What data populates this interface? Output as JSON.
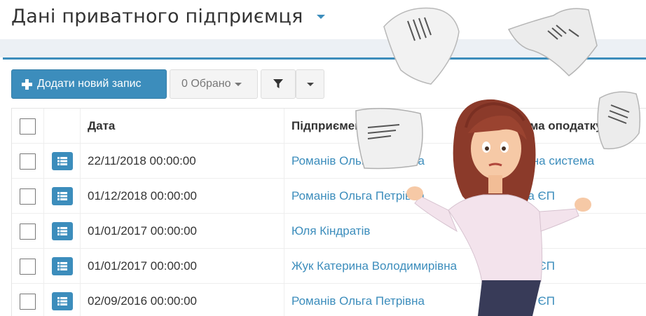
{
  "page": {
    "title": "Дані приватного підприємця"
  },
  "toolbar": {
    "add_label": "Додати новий запис",
    "selected_label": "0 Обрано"
  },
  "table": {
    "columns": [
      "Дата",
      "Підприємець",
      "Система оподаткування"
    ],
    "rows": [
      {
        "date": "22/11/2018 00:00:00",
        "entrepreneur": "Романів Ольга Петрівна",
        "tax": "Загальна система"
      },
      {
        "date": "01/12/2018 00:00:00",
        "entrepreneur": "Романів Ольга Петрівна",
        "tax": "3 група ЄП"
      },
      {
        "date": "01/01/2017 00:00:00",
        "entrepreneur": "Юля Кіндратів",
        "tax": ""
      },
      {
        "date": "01/01/2017 00:00:00",
        "entrepreneur": "Жук Катерина Володимирівна",
        "tax": "3 група ЄП"
      },
      {
        "date": "02/09/2016 00:00:00",
        "entrepreneur": "Романів Ольга Петрівна",
        "tax": "3 група ЄП"
      }
    ]
  },
  "colors": {
    "accent": "#3c8dbc",
    "band": "#ecf0f5",
    "button_bg": "#f4f4f4"
  },
  "icons": [
    "chevron-down-icon",
    "plus-icon",
    "caret-down-icon",
    "filter-icon",
    "list-icon"
  ]
}
